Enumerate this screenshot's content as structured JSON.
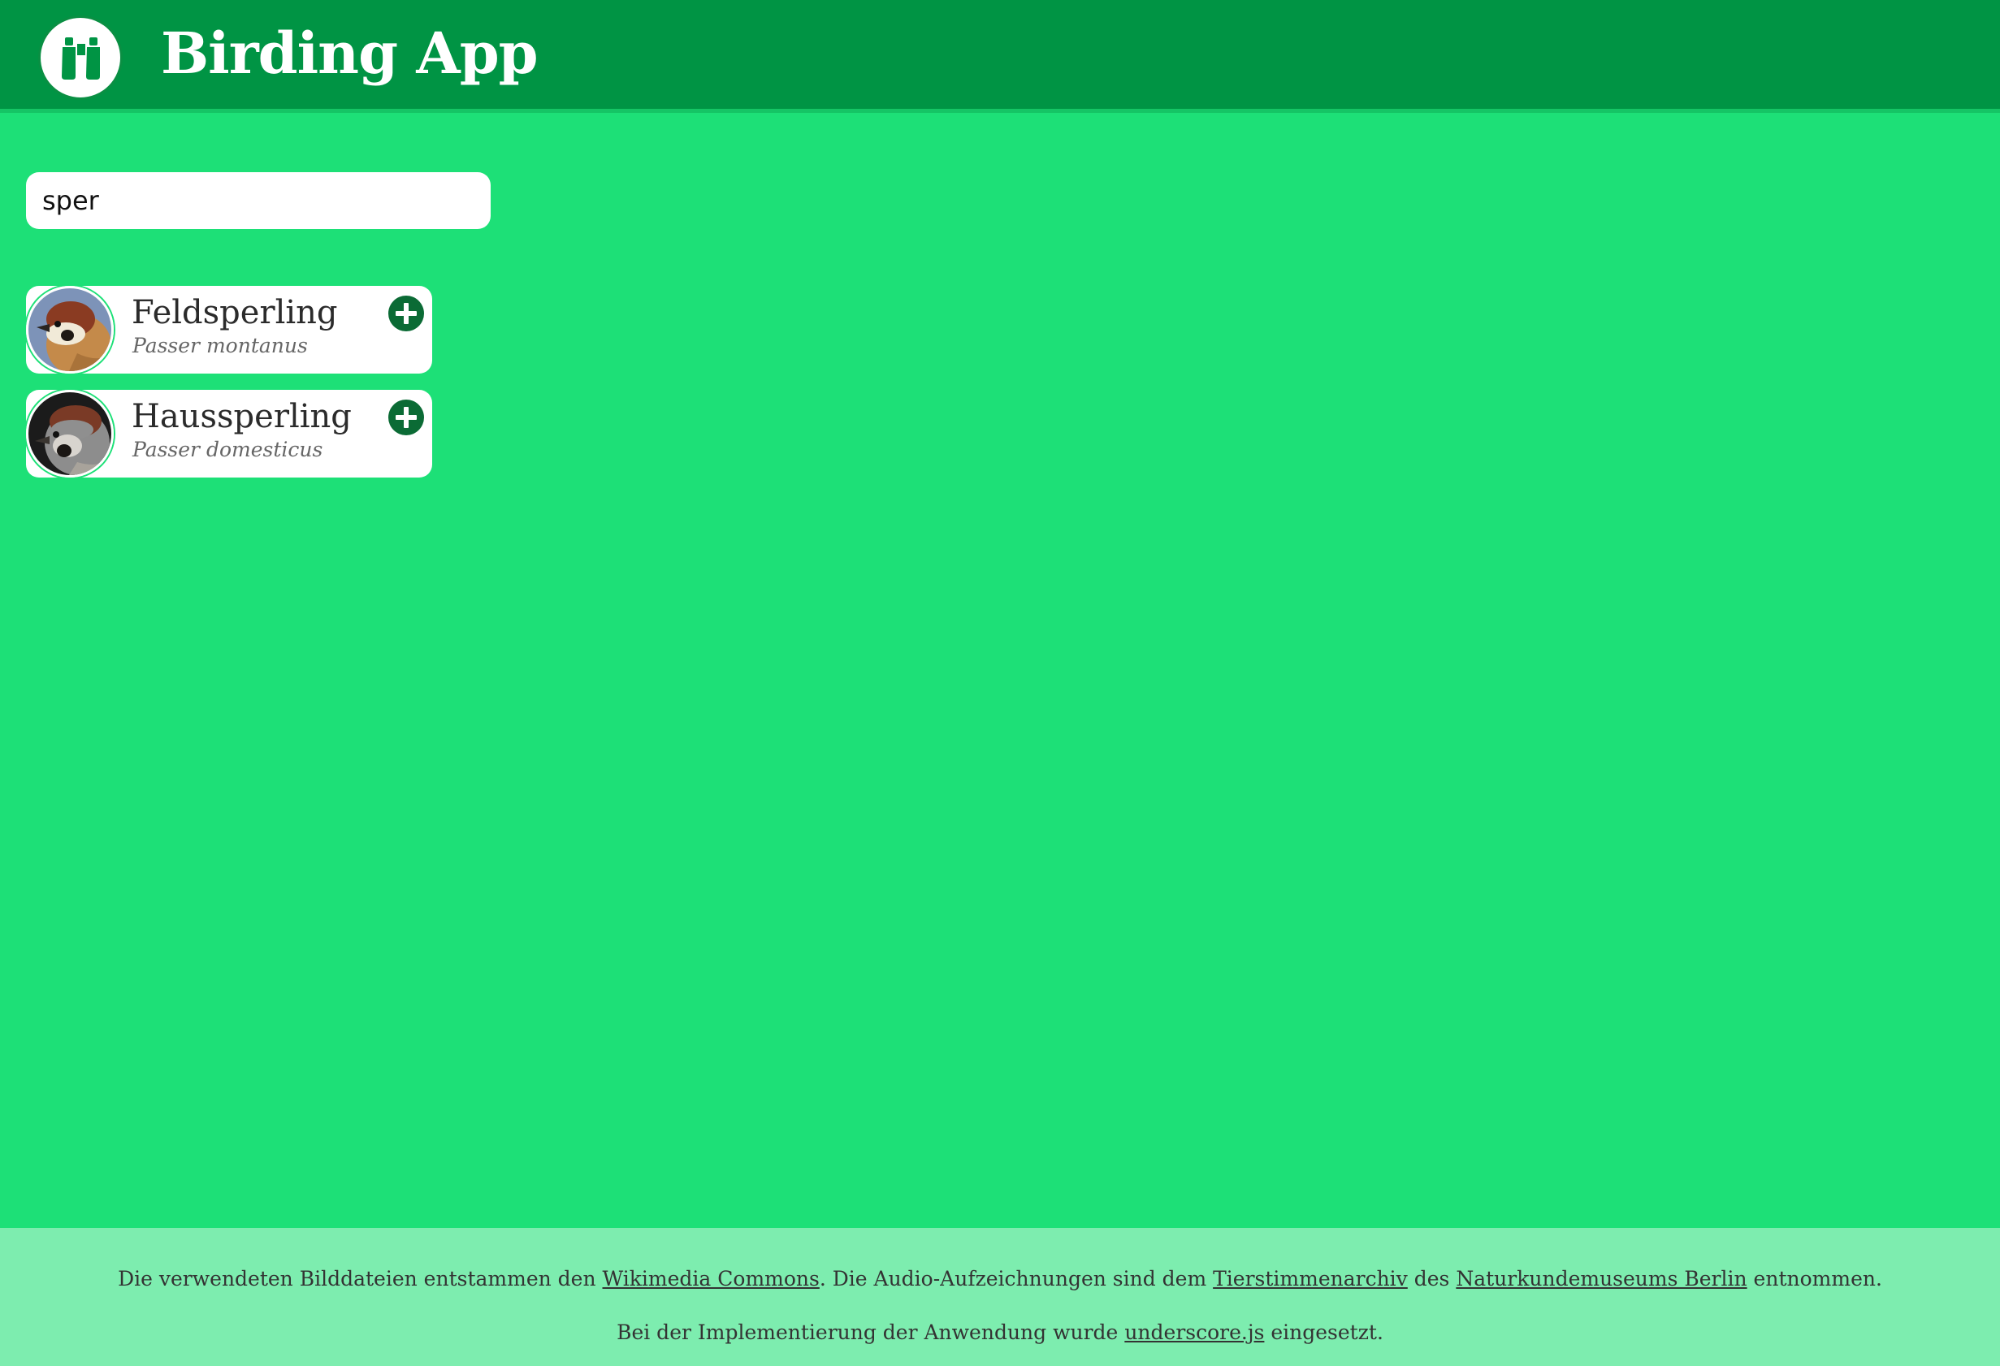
{
  "header": {
    "title": "Birding App",
    "logo_icon": "binoculars-icon",
    "background_color": "#009444"
  },
  "search": {
    "value": "sper",
    "placeholder": ""
  },
  "results": [
    {
      "common_name": "Feldsperling",
      "latin_name": "Passer montanus",
      "image_icon": "bird-photo",
      "action_icon": "plus-circle-icon"
    },
    {
      "common_name": "Haussperling",
      "latin_name": "Passer domesticus",
      "image_icon": "bird-photo",
      "action_icon": "plus-circle-icon"
    }
  ],
  "footer": {
    "line1": {
      "t1": "Die verwendeten Bilddateien entstammen den ",
      "link1": "Wikimedia Commons",
      "t2": ". Die Audio-Aufzeichnungen sind dem ",
      "link2": "Tierstimmenarchiv",
      "t3": " des ",
      "link3": "Naturkundemuseums Berlin",
      "t4": " entnommen."
    },
    "line2": {
      "t1": "Bei der Implementierung der Anwendung wurde ",
      "link1": "underscore.js",
      "t2": " eingesetzt."
    }
  },
  "colors": {
    "page_background": "#1de077",
    "header": "#009444",
    "footer": "#7dedaf",
    "accent_button": "#0b6b35"
  }
}
